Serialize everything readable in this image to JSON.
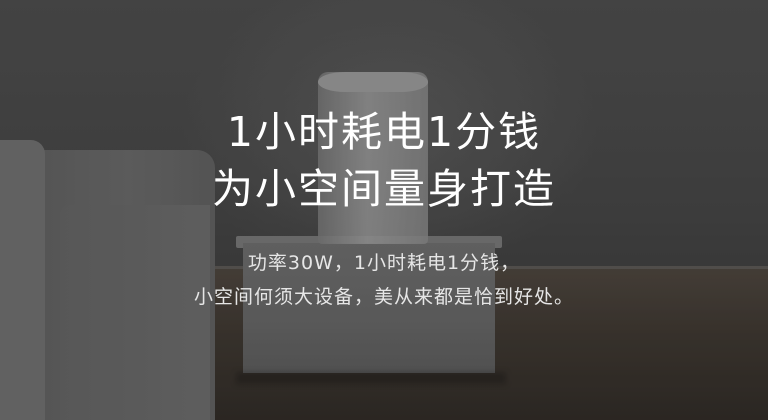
{
  "headline": {
    "line1": "1小时耗电1分钱",
    "line2": "为小空间量身打造"
  },
  "subtext": {
    "line1": "功率30W，1小时耗电1分钱，",
    "line2": "小空间何须大设备，美从来都是恰到好处。"
  }
}
